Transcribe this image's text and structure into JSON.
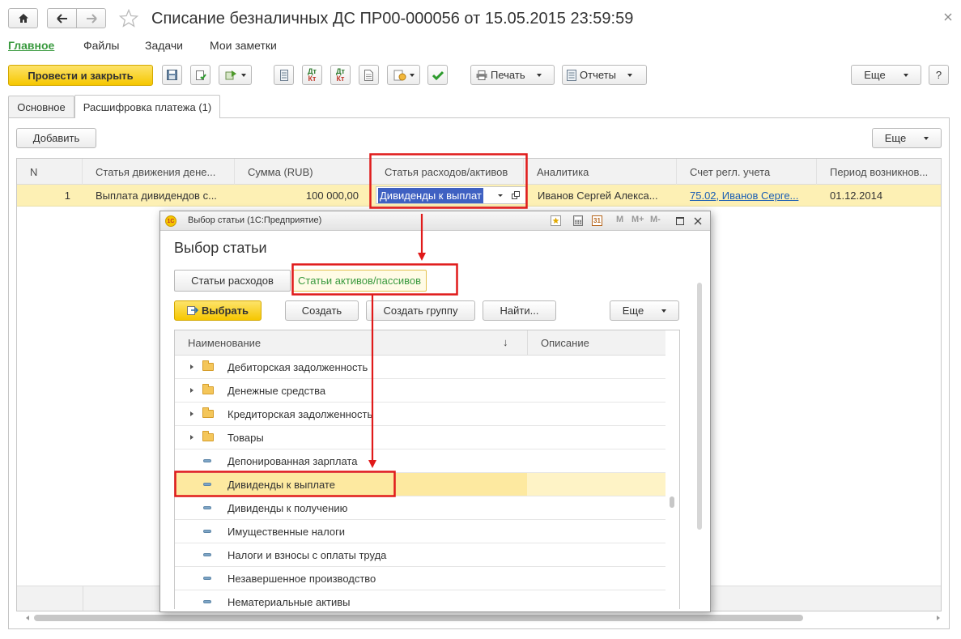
{
  "window": {
    "title": "Списание безналичных ДС ПР00-000056 от 15.05.2015 23:59:59"
  },
  "sections": [
    "Главное",
    "Файлы",
    "Задачи",
    "Мои заметки"
  ],
  "toolbar": {
    "post_close": "Провести и закрыть",
    "dt_label": "Дт",
    "kt_label": "Кт",
    "print": "Печать",
    "reports": "Отчеты",
    "more": "Еще",
    "help": "?"
  },
  "tabs": [
    "Основное",
    "Расшифровка платежа (1)"
  ],
  "table": {
    "add_button": "Добавить",
    "more_button": "Еще",
    "columns": [
      "N",
      "Статья движения дене...",
      "Сумма (RUB)",
      "Статья расходов/активов",
      "Аналитика",
      "Счет регл. учета",
      "Период возникнов..."
    ],
    "row": {
      "n": "1",
      "cash_item": "Выплата дивидендов с...",
      "amount": "100 000,00",
      "expense_item": "Дивиденды к выплат",
      "analytics": "Иванов Сергей Алекса...",
      "account": "75.02, Иванов Серге...",
      "period": "01.12.2014"
    }
  },
  "dialog": {
    "window_title": "Выбор статьи (1С:Предприятие)",
    "heading": "Выбор статьи",
    "tabs": [
      "Статьи расходов",
      "Статьи активов/пассивов"
    ],
    "select_button": "Выбрать",
    "create_button": "Создать",
    "create_group_button": "Создать группу",
    "find_button": "Найти...",
    "more_button": "Еще",
    "title_buttons": [
      "M",
      "M+",
      "M-"
    ],
    "calendar_label": "31",
    "columns": [
      "Наименование",
      "Описание"
    ],
    "sort_arrow": "↓",
    "items": [
      {
        "name": "Дебиторская задолженность",
        "type": "folder"
      },
      {
        "name": "Денежные средства",
        "type": "folder"
      },
      {
        "name": "Кредиторская задолженность",
        "type": "folder"
      },
      {
        "name": "Товары",
        "type": "folder"
      },
      {
        "name": "Депонированная зарплата",
        "type": "item"
      },
      {
        "name": "Дивиденды к выплате",
        "type": "item",
        "selected": true
      },
      {
        "name": "Дивиденды к получению",
        "type": "item"
      },
      {
        "name": "Имущественные налоги",
        "type": "item"
      },
      {
        "name": "Налоги и взносы с оплаты труда",
        "type": "item"
      },
      {
        "name": "Незавершенное производство",
        "type": "item"
      },
      {
        "name": "Нематериальные активы",
        "type": "item"
      }
    ]
  },
  "colors": {
    "highlight_row": "#fdf0b4",
    "accent_yellow": "#fcd838",
    "annotation_red": "#e01a1a",
    "link_green": "#3a9a3f",
    "selection_blue": "#3f61c2"
  }
}
